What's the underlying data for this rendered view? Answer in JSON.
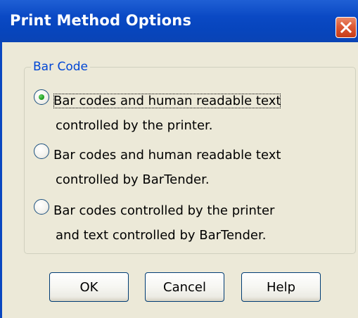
{
  "dialog": {
    "title": "Print Method Options"
  },
  "group": {
    "label": "Bar Code"
  },
  "options": [
    {
      "line1": "Bar codes and human readable text",
      "line2": "controlled by the printer.",
      "selected": true
    },
    {
      "line1": "Bar codes and human readable text",
      "line2": "controlled by BarTender.",
      "selected": false
    },
    {
      "line1": "Bar codes controlled by the printer",
      "line2": "and text controlled by BarTender.",
      "selected": false
    }
  ],
  "buttons": {
    "ok": "OK",
    "cancel": "Cancel",
    "help": "Help"
  },
  "icons": {
    "close": "close-icon"
  },
  "colors": {
    "titlebar": "#0a49c4",
    "close_button": "#dd5a36",
    "group_label": "#0046d5",
    "dialog_background": "#ece9d8",
    "radio_selected_dot": "#21a121"
  }
}
